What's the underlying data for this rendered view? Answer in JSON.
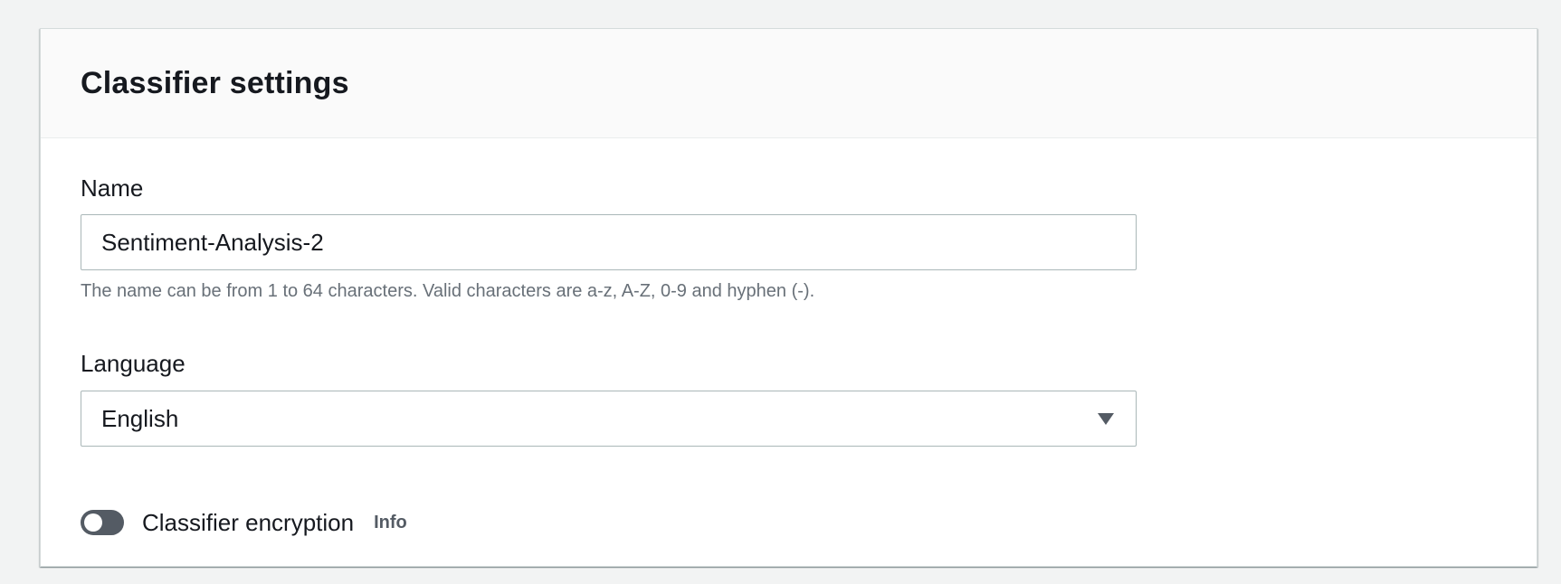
{
  "panel": {
    "title": "Classifier settings"
  },
  "name_field": {
    "label": "Name",
    "value": "Sentiment-Analysis-2",
    "constraint": "The name can be from 1 to 64 characters. Valid characters are a-z, A-Z, 0-9 and hyphen (-)."
  },
  "language_field": {
    "label": "Language",
    "selected": "English",
    "icon": "caret-down-icon"
  },
  "encryption": {
    "label": "Classifier encryption",
    "info_label": "Info",
    "enabled": false
  },
  "colors": {
    "background": "#f2f3f3",
    "panel": "#ffffff",
    "header": "#fafafa",
    "text": "#16191f",
    "muted_text": "#687078",
    "toggle_off": "#545b64",
    "border": "#aab7b8"
  }
}
